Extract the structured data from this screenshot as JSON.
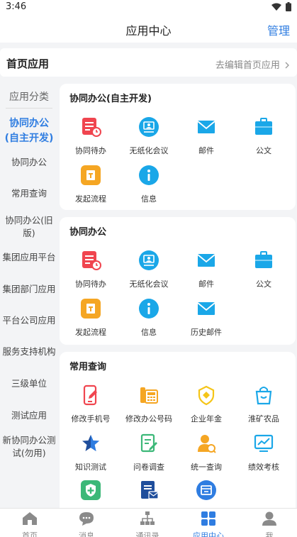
{
  "status_bar": {
    "time": "3:46"
  },
  "header": {
    "title": "应用中心",
    "manage": "管理"
  },
  "home_apps": {
    "label": "首页应用",
    "edit": "去编辑首页应用"
  },
  "sidebar": {
    "title": "应用分类",
    "items": [
      {
        "label": "协同办公(自主开发)"
      },
      {
        "label": "协同办公"
      },
      {
        "label": "常用查询"
      },
      {
        "label": "协同办公(旧版)"
      },
      {
        "label": "集团应用平台"
      },
      {
        "label": "集团部门应用"
      },
      {
        "label": "平台公司应用"
      },
      {
        "label": "服务支持机构"
      },
      {
        "label": "三级单位"
      },
      {
        "label": "测试应用"
      },
      {
        "label": "新协同办公测试(勿用)"
      }
    ]
  },
  "sections": [
    {
      "title": "协同办公(自主开发)",
      "apps": [
        {
          "label": "协同待办"
        },
        {
          "label": "无纸化会议"
        },
        {
          "label": "邮件"
        },
        {
          "label": "公文"
        },
        {
          "label": "发起流程"
        },
        {
          "label": "信息"
        }
      ]
    },
    {
      "title": "协同办公",
      "apps": [
        {
          "label": "协同待办"
        },
        {
          "label": "无纸化会议"
        },
        {
          "label": "邮件"
        },
        {
          "label": "公文"
        },
        {
          "label": "发起流程"
        },
        {
          "label": "信息"
        },
        {
          "label": "历史邮件"
        }
      ]
    },
    {
      "title": "常用查询",
      "apps": [
        {
          "label": "修改手机号"
        },
        {
          "label": "修改办公号码"
        },
        {
          "label": "企业年金"
        },
        {
          "label": "淮矿农品"
        },
        {
          "label": "知识测试"
        },
        {
          "label": "问卷调查"
        },
        {
          "label": "统一查询"
        },
        {
          "label": "绩效考核"
        }
      ]
    }
  ],
  "tabbar": {
    "items": [
      {
        "label": "首页"
      },
      {
        "label": "消息"
      },
      {
        "label": "通讯录"
      },
      {
        "label": "应用中心"
      },
      {
        "label": "我"
      }
    ]
  },
  "colors": {
    "accent": "#2f7de1",
    "red": "#f0454f",
    "orange": "#f5a623",
    "cyan": "#1aa7e8",
    "green": "#3cb878",
    "navy": "#1f4e9c"
  }
}
